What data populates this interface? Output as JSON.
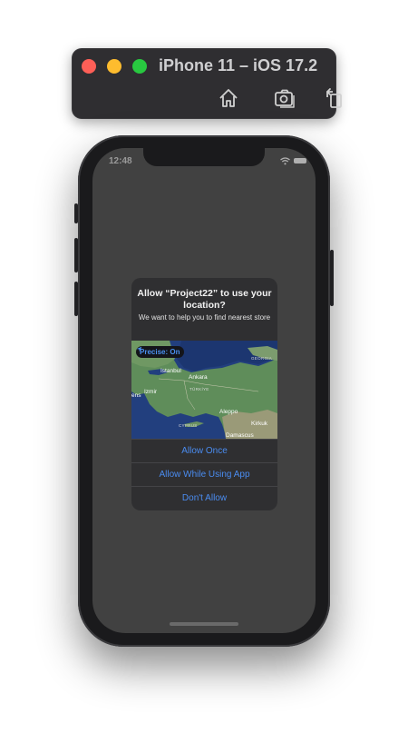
{
  "window": {
    "title": "iPhone 11 – iOS 17.2",
    "toolbar": [
      {
        "icon": "home-icon"
      },
      {
        "icon": "screenshot-icon"
      },
      {
        "icon": "rotate-icon"
      }
    ]
  },
  "status_bar": {
    "time": "12:48"
  },
  "alert": {
    "title": "Allow “Project22” to use your location?",
    "message": "We want to help you to find nearest store",
    "precise_label": "Precise: On",
    "map_labels": {
      "istanbul": "Istanbul",
      "ankara": "Ankara",
      "izmir": "Izmir",
      "ens": "ens",
      "turkiye": "TÜRKİYE",
      "georgia": "GEORGIA",
      "cyprus": "CYPRUS",
      "aleppo": "Aleppo",
      "kirkuk": "Kirkuk",
      "damascus": "Damascus"
    },
    "buttons": {
      "allow_once": "Allow Once",
      "allow_while": "Allow While Using App",
      "dont_allow": "Don't Allow"
    }
  },
  "colors": {
    "accent": "#4a8cf0",
    "screen": "#414141",
    "alert_bg": "#2f2f31",
    "traffic_red": "#fe5f57",
    "traffic_yellow": "#febc2e",
    "traffic_green": "#28c840"
  }
}
